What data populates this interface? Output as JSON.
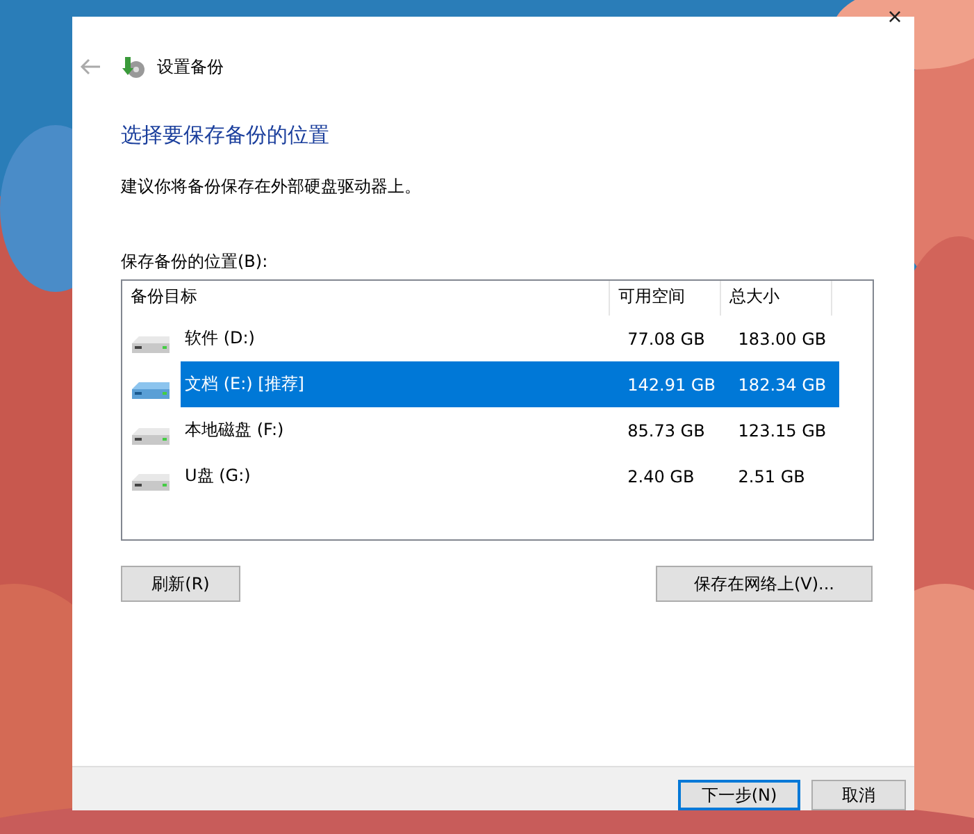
{
  "window": {
    "title": "设置备份",
    "close": "×"
  },
  "heading": "选择要保存备份的位置",
  "description": "建议你将备份保存在外部硬盘驱动器上。",
  "list_label": "保存备份的位置(B):",
  "table": {
    "columns": [
      "备份目标",
      "可用空间",
      "总大小"
    ],
    "rows": [
      {
        "name": "软件 (D:)",
        "free": "77.08 GB",
        "total": "183.00 GB",
        "selected": false
      },
      {
        "name": "文档 (E:) [推荐]",
        "free": "142.91 GB",
        "total": "182.34 GB",
        "selected": true
      },
      {
        "name": "本地磁盘 (F:)",
        "free": "85.73 GB",
        "total": "123.15 GB",
        "selected": false
      },
      {
        "name": "U盘 (G:)",
        "free": "2.40 GB",
        "total": "2.51 GB",
        "selected": false
      }
    ]
  },
  "buttons": [
    {
      "label": "刷新(R)",
      "kind": "left"
    },
    {
      "label": "保存在网络上(V)...",
      "kind": "right"
    }
  ],
  "footer_buttons": [
    {
      "label": "下一步(N)",
      "selected": true
    },
    {
      "label": "取消",
      "selected": false
    }
  ]
}
